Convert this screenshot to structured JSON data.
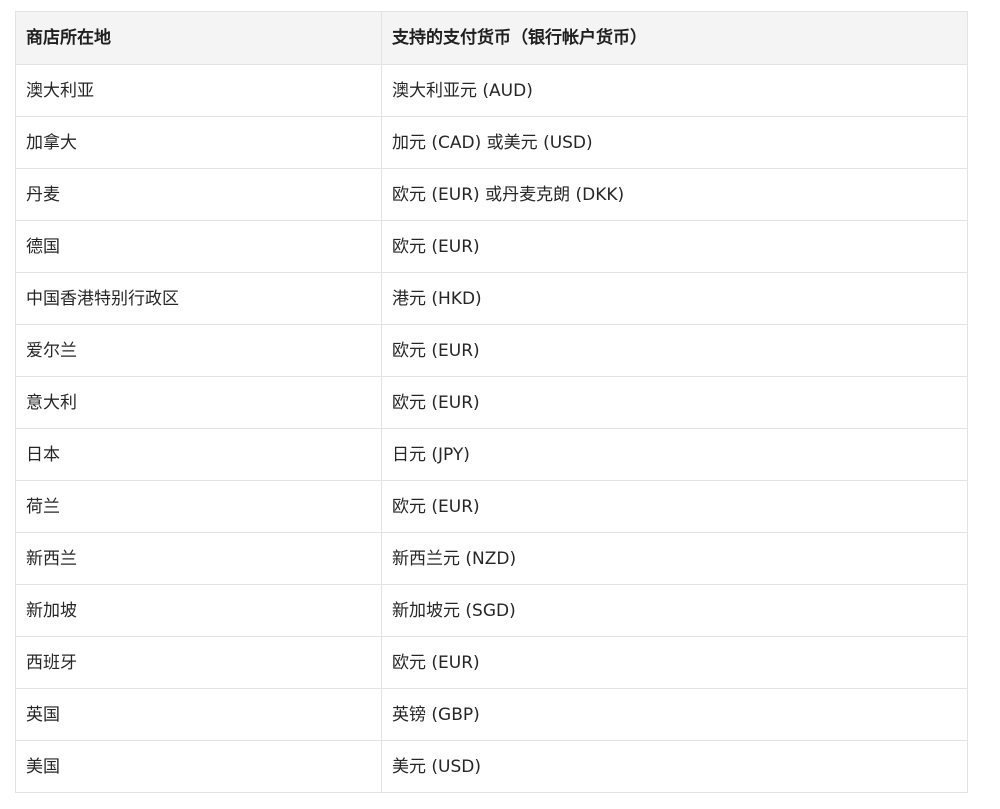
{
  "table": {
    "headers": [
      "商店所在地",
      "支持的支付货币（银行帐户货币）"
    ],
    "rows": [
      [
        "澳大利亚",
        "澳大利亚元 (AUD)"
      ],
      [
        "加拿大",
        "加元 (CAD) 或美元 (USD)"
      ],
      [
        "丹麦",
        "欧元 (EUR) 或丹麦克朗 (DKK)"
      ],
      [
        "德国",
        "欧元 (EUR)"
      ],
      [
        "中国香港特别行政区",
        "港元 (HKD)"
      ],
      [
        "爱尔兰",
        "欧元 (EUR)"
      ],
      [
        "意大利",
        "欧元 (EUR)"
      ],
      [
        "日本",
        "日元 (JPY)"
      ],
      [
        "荷兰",
        "欧元 (EUR)"
      ],
      [
        "新西兰",
        "新西兰元 (NZD)"
      ],
      [
        "新加坡",
        "新加坡元 (SGD)"
      ],
      [
        "西班牙",
        "欧元 (EUR)"
      ],
      [
        "英国",
        "英镑 (GBP)"
      ],
      [
        "美国",
        "美元 (USD)"
      ]
    ]
  },
  "colors": {
    "header_background": "#f4f4f4",
    "border": "#e3e3e3",
    "text": "#262626"
  }
}
